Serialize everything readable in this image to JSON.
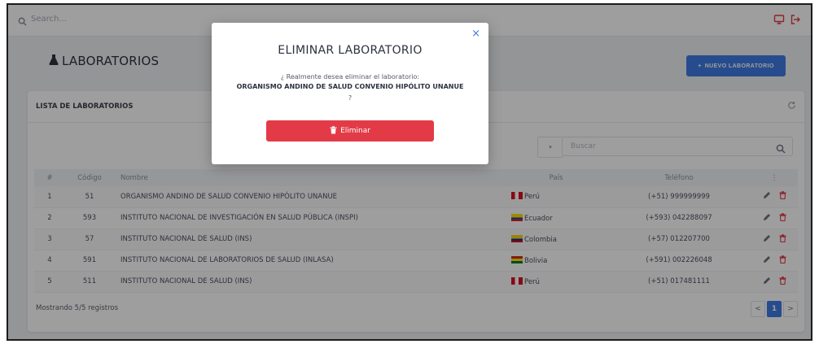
{
  "topbar": {
    "search_placeholder": "Search..."
  },
  "page": {
    "title": "LABORATORIOS",
    "new_button_label": "NUEVO LABORATORIO",
    "new_button_icon": "+"
  },
  "card": {
    "title": "LISTA DE LABORATORIOS",
    "search_placeholder": "Buscar",
    "columns": [
      "#",
      "Código",
      "Nombre",
      "País",
      "Teléfono",
      "⋮"
    ],
    "rows": [
      {
        "n": "1",
        "code": "51",
        "name": "ORGANISMO ANDINO DE SALUD CONVENIO HIPÓLITO UNANUE",
        "country": "Perú",
        "flag": "peru",
        "phone": "(+51) 999999999"
      },
      {
        "n": "2",
        "code": "593",
        "name": "INSTITUTO NACIONAL DE INVESTIGACIÓN EN SALUD PÚBLICA (INSPI)",
        "country": "Ecuador",
        "flag": "ecuador",
        "phone": "(+593) 042288097"
      },
      {
        "n": "3",
        "code": "57",
        "name": "INSTITUTO NACIONAL DE SALUD (INS)",
        "country": "Colombia",
        "flag": "colombia",
        "phone": "(+57) 012207700"
      },
      {
        "n": "4",
        "code": "591",
        "name": "INSTITUTO NACIONAL DE LABORATORIOS DE SALUD (INLASA)",
        "country": "Bolivia",
        "flag": "bolivia",
        "phone": "(+591) 002226048"
      },
      {
        "n": "5",
        "code": "511",
        "name": "INSTITUTO NACIONAL DE SALUD (INS)",
        "country": "Perú",
        "flag": "peru",
        "phone": "(+51) 017481111"
      }
    ],
    "footer_text": "Mostrando 5/5 registros",
    "pager": {
      "prev": "<",
      "current": "1",
      "next": ">"
    }
  },
  "modal": {
    "close": "×",
    "title": "ELIMINAR LABORATORIO",
    "question": "¿ Realmente desea eliminar el laboratorio:",
    "lab_name": "ORGANISMO ANDINO DE SALUD CONVENIO HIPÓLITO UNANUE",
    "question_end": "?",
    "delete_label": "Eliminar"
  },
  "colors": {
    "primary": "#3f7be6",
    "danger": "#e23b47",
    "edit_icon": "#6b7280"
  },
  "icons": {
    "search": "search-icon",
    "monitor": "monitor-icon",
    "logout": "logout-icon",
    "flask": "flask-icon",
    "refresh": "refresh-icon",
    "edit": "pencil-icon",
    "delete": "trash-icon"
  }
}
